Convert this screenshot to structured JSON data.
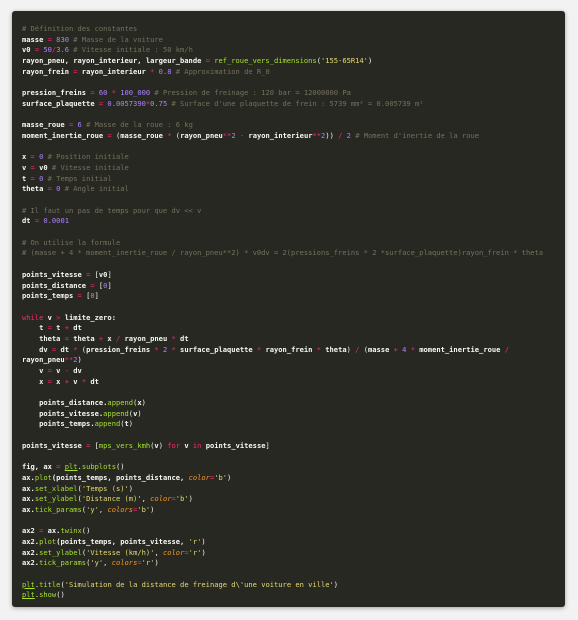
{
  "code_lines": [
    [
      {
        "t": "# Définition des constantes",
        "c": "c"
      }
    ],
    [
      {
        "t": "masse",
        "c": "nb"
      },
      {
        "t": " = ",
        "c": "o"
      },
      {
        "t": "830",
        "c": "m"
      },
      {
        "t": " # Masse de la voiture",
        "c": "c"
      }
    ],
    [
      {
        "t": "v0",
        "c": "nb"
      },
      {
        "t": " = ",
        "c": "o"
      },
      {
        "t": "50",
        "c": "m"
      },
      {
        "t": "/",
        "c": "o"
      },
      {
        "t": "3.6",
        "c": "m"
      },
      {
        "t": " # Vitesse initiale : 50 km/h",
        "c": "c"
      }
    ],
    [
      {
        "t": "rayon_pneu, rayon_interieur, largeur_bande",
        "c": "nb"
      },
      {
        "t": " = ",
        "c": "o"
      },
      {
        "t": "ref_roue_vers_dimensions",
        "c": "f"
      },
      {
        "t": "(",
        "c": "n"
      },
      {
        "t": "'155-65R14'",
        "c": "s"
      },
      {
        "t": ")",
        "c": "n"
      }
    ],
    [
      {
        "t": "rayon_frein",
        "c": "nb"
      },
      {
        "t": " = ",
        "c": "o"
      },
      {
        "t": "rayon_interieur",
        "c": "nb"
      },
      {
        "t": " * ",
        "c": "o"
      },
      {
        "t": "0.8",
        "c": "m"
      },
      {
        "t": " # Approximation de R_0",
        "c": "c"
      }
    ],
    [],
    [
      {
        "t": "pression_freins",
        "c": "nb"
      },
      {
        "t": " = ",
        "c": "o"
      },
      {
        "t": "60",
        "c": "m"
      },
      {
        "t": " * ",
        "c": "o"
      },
      {
        "t": "100_000",
        "c": "m"
      },
      {
        "t": " # Pression de freinage : 120 bar = 12000000 Pa",
        "c": "c"
      }
    ],
    [
      {
        "t": "surface_plaquette",
        "c": "nb"
      },
      {
        "t": " = ",
        "c": "o"
      },
      {
        "t": "0.0057390",
        "c": "m"
      },
      {
        "t": "*",
        "c": "o"
      },
      {
        "t": "0.75",
        "c": "m"
      },
      {
        "t": " # Surface d'une plaquette de frein : 5739 mm² = 0.005739 m²",
        "c": "c"
      }
    ],
    [],
    [
      {
        "t": "masse_roue",
        "c": "nb"
      },
      {
        "t": " = ",
        "c": "o"
      },
      {
        "t": "6",
        "c": "m"
      },
      {
        "t": " # Masse de la roue : 6 kg",
        "c": "c"
      }
    ],
    [
      {
        "t": "moment_inertie_roue",
        "c": "nb"
      },
      {
        "t": " = ",
        "c": "o"
      },
      {
        "t": "(",
        "c": "n"
      },
      {
        "t": "masse_roue",
        "c": "nb"
      },
      {
        "t": " * ",
        "c": "o"
      },
      {
        "t": "(",
        "c": "n"
      },
      {
        "t": "rayon_pneu",
        "c": "nb"
      },
      {
        "t": "**",
        "c": "o"
      },
      {
        "t": "2",
        "c": "m"
      },
      {
        "t": " - ",
        "c": "o"
      },
      {
        "t": "rayon_interieur",
        "c": "nb"
      },
      {
        "t": "**",
        "c": "o"
      },
      {
        "t": "2",
        "c": "m"
      },
      {
        "t": ")) ",
        "c": "n"
      },
      {
        "t": "/",
        "c": "o"
      },
      {
        "t": " 2",
        "c": "m"
      },
      {
        "t": " # Moment d'inertie de la roue",
        "c": "c"
      }
    ],
    [],
    [
      {
        "t": "x",
        "c": "nb"
      },
      {
        "t": " = ",
        "c": "o"
      },
      {
        "t": "0",
        "c": "m"
      },
      {
        "t": " # Position initiale",
        "c": "c"
      }
    ],
    [
      {
        "t": "v",
        "c": "nb"
      },
      {
        "t": " = ",
        "c": "o"
      },
      {
        "t": "v0",
        "c": "nb"
      },
      {
        "t": " # Vitesse initiale",
        "c": "c"
      }
    ],
    [
      {
        "t": "t",
        "c": "nb"
      },
      {
        "t": " = ",
        "c": "o"
      },
      {
        "t": "0",
        "c": "m"
      },
      {
        "t": " # Temps initial",
        "c": "c"
      }
    ],
    [
      {
        "t": "theta",
        "c": "nb"
      },
      {
        "t": " = ",
        "c": "o"
      },
      {
        "t": "0",
        "c": "m"
      },
      {
        "t": " # Angle initial",
        "c": "c"
      }
    ],
    [],
    [
      {
        "t": "# Il faut un pas de temps pour que dv << v",
        "c": "c"
      }
    ],
    [
      {
        "t": "dt",
        "c": "nb"
      },
      {
        "t": " = ",
        "c": "o"
      },
      {
        "t": "0.0001",
        "c": "m"
      }
    ],
    [],
    [
      {
        "t": "# On utilise la formule",
        "c": "c"
      }
    ],
    [
      {
        "t": "# (masse + 4 * moment_inertie_roue / rayon_pneu**2) * v0dv = 2(pressions_freins * 2 *surface_plaquette)rayon_frein * theta",
        "c": "c"
      }
    ],
    [],
    [
      {
        "t": "points_vitesse",
        "c": "nb"
      },
      {
        "t": " = ",
        "c": "o"
      },
      {
        "t": "[",
        "c": "n"
      },
      {
        "t": "v0",
        "c": "nb"
      },
      {
        "t": "]",
        "c": "n"
      }
    ],
    [
      {
        "t": "points_distance",
        "c": "nb"
      },
      {
        "t": " = ",
        "c": "o"
      },
      {
        "t": "[",
        "c": "n"
      },
      {
        "t": "0",
        "c": "m"
      },
      {
        "t": "]",
        "c": "n"
      }
    ],
    [
      {
        "t": "points_temps",
        "c": "nb"
      },
      {
        "t": " = ",
        "c": "o"
      },
      {
        "t": "[",
        "c": "n"
      },
      {
        "t": "0",
        "c": "m"
      },
      {
        "t": "]",
        "c": "n"
      }
    ],
    [],
    [
      {
        "t": "while",
        "c": "k"
      },
      {
        "t": " v ",
        "c": "nb"
      },
      {
        "t": ">",
        "c": "o"
      },
      {
        "t": " limite_zero:",
        "c": "nb"
      }
    ],
    [
      {
        "t": "    t",
        "c": "nb"
      },
      {
        "t": " = ",
        "c": "o"
      },
      {
        "t": "t",
        "c": "nb"
      },
      {
        "t": " + ",
        "c": "o"
      },
      {
        "t": "dt",
        "c": "nb"
      }
    ],
    [
      {
        "t": "    theta",
        "c": "nb"
      },
      {
        "t": " = ",
        "c": "o"
      },
      {
        "t": "theta",
        "c": "nb"
      },
      {
        "t": " + ",
        "c": "o"
      },
      {
        "t": "x",
        "c": "nb"
      },
      {
        "t": " / ",
        "c": "o"
      },
      {
        "t": "rayon_pneu",
        "c": "nb"
      },
      {
        "t": " * ",
        "c": "o"
      },
      {
        "t": "dt",
        "c": "nb"
      }
    ],
    [
      {
        "t": "    dv",
        "c": "nb"
      },
      {
        "t": " = ",
        "c": "o"
      },
      {
        "t": "dt",
        "c": "nb"
      },
      {
        "t": " * ",
        "c": "o"
      },
      {
        "t": "(",
        "c": "n"
      },
      {
        "t": "pression_freins",
        "c": "nb"
      },
      {
        "t": " * ",
        "c": "o"
      },
      {
        "t": "2",
        "c": "m"
      },
      {
        "t": " * ",
        "c": "o"
      },
      {
        "t": "surface_plaquette",
        "c": "nb"
      },
      {
        "t": " * ",
        "c": "o"
      },
      {
        "t": "rayon_frein",
        "c": "nb"
      },
      {
        "t": " * ",
        "c": "o"
      },
      {
        "t": "theta",
        "c": "nb"
      },
      {
        "t": ") ",
        "c": "n"
      },
      {
        "t": "/",
        "c": "o"
      },
      {
        "t": " (",
        "c": "n"
      },
      {
        "t": "masse",
        "c": "nb"
      },
      {
        "t": " + ",
        "c": "o"
      },
      {
        "t": "4",
        "c": "m"
      },
      {
        "t": " * ",
        "c": "o"
      },
      {
        "t": "moment_inertie_roue",
        "c": "nb"
      },
      {
        "t": " /",
        "c": "o"
      }
    ],
    [
      {
        "t": "rayon_pneu",
        "c": "nb"
      },
      {
        "t": "**",
        "c": "o"
      },
      {
        "t": "2",
        "c": "m"
      },
      {
        "t": ")",
        "c": "n"
      }
    ],
    [
      {
        "t": "    v",
        "c": "nb"
      },
      {
        "t": " = ",
        "c": "o"
      },
      {
        "t": "v",
        "c": "nb"
      },
      {
        "t": " - ",
        "c": "o"
      },
      {
        "t": "dv",
        "c": "nb"
      }
    ],
    [
      {
        "t": "    x",
        "c": "nb"
      },
      {
        "t": " = ",
        "c": "o"
      },
      {
        "t": "x",
        "c": "nb"
      },
      {
        "t": " + ",
        "c": "o"
      },
      {
        "t": "v",
        "c": "nb"
      },
      {
        "t": " * ",
        "c": "o"
      },
      {
        "t": "dt",
        "c": "nb"
      }
    ],
    [],
    [
      {
        "t": "    points_distance.",
        "c": "nb"
      },
      {
        "t": "append",
        "c": "f"
      },
      {
        "t": "(",
        "c": "n"
      },
      {
        "t": "x",
        "c": "nb"
      },
      {
        "t": ")",
        "c": "n"
      }
    ],
    [
      {
        "t": "    points_vitesse.",
        "c": "nb"
      },
      {
        "t": "append",
        "c": "f"
      },
      {
        "t": "(",
        "c": "n"
      },
      {
        "t": "v",
        "c": "nb"
      },
      {
        "t": ")",
        "c": "n"
      }
    ],
    [
      {
        "t": "    points_temps.",
        "c": "nb"
      },
      {
        "t": "append",
        "c": "f"
      },
      {
        "t": "(",
        "c": "n"
      },
      {
        "t": "t",
        "c": "nb"
      },
      {
        "t": ")",
        "c": "n"
      }
    ],
    [],
    [
      {
        "t": "points_vitesse",
        "c": "nb"
      },
      {
        "t": " = ",
        "c": "o"
      },
      {
        "t": "[",
        "c": "n"
      },
      {
        "t": "mps_vers_kmh",
        "c": "f"
      },
      {
        "t": "(",
        "c": "n"
      },
      {
        "t": "v",
        "c": "nb"
      },
      {
        "t": ") ",
        "c": "n"
      },
      {
        "t": "for",
        "c": "k"
      },
      {
        "t": " v ",
        "c": "nb"
      },
      {
        "t": "in",
        "c": "k"
      },
      {
        "t": " points_vitesse",
        "c": "nb"
      },
      {
        "t": "]",
        "c": "n"
      }
    ],
    [],
    [
      {
        "t": "fig, ax",
        "c": "nb"
      },
      {
        "t": " = ",
        "c": "o"
      },
      {
        "t": "plt",
        "c": "u"
      },
      {
        "t": ".",
        "c": "n"
      },
      {
        "t": "subplots",
        "c": "f"
      },
      {
        "t": "()",
        "c": "n"
      }
    ],
    [
      {
        "t": "ax.",
        "c": "nb"
      },
      {
        "t": "plot",
        "c": "f"
      },
      {
        "t": "(points_temps, points_distance, ",
        "c": "nb"
      },
      {
        "t": "color",
        "c": "kw"
      },
      {
        "t": "=",
        "c": "o"
      },
      {
        "t": "'b'",
        "c": "s"
      },
      {
        "t": ")",
        "c": "n"
      }
    ],
    [
      {
        "t": "ax.",
        "c": "nb"
      },
      {
        "t": "set_xlabel",
        "c": "f"
      },
      {
        "t": "(",
        "c": "n"
      },
      {
        "t": "'Temps (s)'",
        "c": "s"
      },
      {
        "t": ")",
        "c": "n"
      }
    ],
    [
      {
        "t": "ax.",
        "c": "nb"
      },
      {
        "t": "set_ylabel",
        "c": "f"
      },
      {
        "t": "(",
        "c": "n"
      },
      {
        "t": "'Distance (m)'",
        "c": "s"
      },
      {
        "t": ", ",
        "c": "n"
      },
      {
        "t": "color",
        "c": "kw"
      },
      {
        "t": "=",
        "c": "o"
      },
      {
        "t": "'b'",
        "c": "s"
      },
      {
        "t": ")",
        "c": "n"
      }
    ],
    [
      {
        "t": "ax.",
        "c": "nb"
      },
      {
        "t": "tick_params",
        "c": "f"
      },
      {
        "t": "(",
        "c": "n"
      },
      {
        "t": "'y'",
        "c": "s"
      },
      {
        "t": ", ",
        "c": "n"
      },
      {
        "t": "colors",
        "c": "kw"
      },
      {
        "t": "=",
        "c": "o"
      },
      {
        "t": "'b'",
        "c": "s"
      },
      {
        "t": ")",
        "c": "n"
      }
    ],
    [],
    [
      {
        "t": "ax2",
        "c": "nb"
      },
      {
        "t": " = ",
        "c": "o"
      },
      {
        "t": "ax.",
        "c": "nb"
      },
      {
        "t": "twinx",
        "c": "f"
      },
      {
        "t": "()",
        "c": "n"
      }
    ],
    [
      {
        "t": "ax2.",
        "c": "nb"
      },
      {
        "t": "plot",
        "c": "f"
      },
      {
        "t": "(points_temps, points_vitesse, ",
        "c": "nb"
      },
      {
        "t": "'r'",
        "c": "s"
      },
      {
        "t": ")",
        "c": "n"
      }
    ],
    [
      {
        "t": "ax2.",
        "c": "nb"
      },
      {
        "t": "set_ylabel",
        "c": "f"
      },
      {
        "t": "(",
        "c": "n"
      },
      {
        "t": "'Vitesse (km/h)'",
        "c": "s"
      },
      {
        "t": ", ",
        "c": "n"
      },
      {
        "t": "color",
        "c": "kw"
      },
      {
        "t": "=",
        "c": "o"
      },
      {
        "t": "'r'",
        "c": "s"
      },
      {
        "t": ")",
        "c": "n"
      }
    ],
    [
      {
        "t": "ax2.",
        "c": "nb"
      },
      {
        "t": "tick_params",
        "c": "f"
      },
      {
        "t": "(",
        "c": "n"
      },
      {
        "t": "'y'",
        "c": "s"
      },
      {
        "t": ", ",
        "c": "n"
      },
      {
        "t": "colors",
        "c": "kw"
      },
      {
        "t": "=",
        "c": "o"
      },
      {
        "t": "'r'",
        "c": "s"
      },
      {
        "t": ")",
        "c": "n"
      }
    ],
    [],
    [
      {
        "t": "plt",
        "c": "u"
      },
      {
        "t": ".",
        "c": "n"
      },
      {
        "t": "title",
        "c": "f"
      },
      {
        "t": "(",
        "c": "n"
      },
      {
        "t": "'Simulation de la distance de freinage d\\'une voiture en ville'",
        "c": "s"
      },
      {
        "t": ")",
        "c": "n"
      }
    ],
    [
      {
        "t": "plt",
        "c": "u"
      },
      {
        "t": ".",
        "c": "n"
      },
      {
        "t": "show",
        "c": "f"
      },
      {
        "t": "()",
        "c": "n"
      }
    ]
  ]
}
